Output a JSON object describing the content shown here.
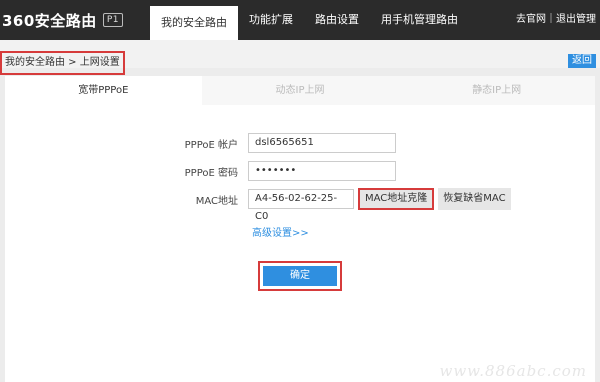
{
  "header": {
    "logo_text": "360安全路由",
    "logo_badge": "P1",
    "nav": [
      {
        "label": "我的安全路由"
      },
      {
        "label": "功能扩展"
      },
      {
        "label": "路由设置"
      },
      {
        "label": "用手机管理路由"
      }
    ],
    "top_links": "去官网｜退出管理"
  },
  "breadcrumb": "我的安全路由 > 上网设置",
  "back_label": "返回",
  "tabs": [
    {
      "label": "宽带PPPoE"
    },
    {
      "label": "动态IP上网"
    },
    {
      "label": "静态IP上网"
    }
  ],
  "form": {
    "account_label": "PPPoE 帐户",
    "account_value": "dsl6565651",
    "password_label": "PPPoE 密码",
    "password_value": "•••••••",
    "mac_label": "MAC地址",
    "mac_value": "A4-56-02-62-25-C0",
    "clone_label": "MAC地址克隆",
    "restore_label": "恢复缺省MAC",
    "advanced_label": "高级设置>>",
    "confirm_label": "确定"
  },
  "watermark": "www.886abc.com"
}
